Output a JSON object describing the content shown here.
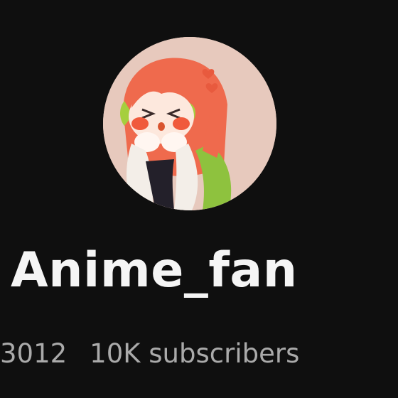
{
  "channel": {
    "name": "Anime_fan",
    "handle": "3012",
    "subscribers": "10K subscribers"
  },
  "avatar": {
    "icon": "anime-girl-avatar",
    "background_color": "#e7c9bd"
  },
  "colors": {
    "background": "#0f0f0f",
    "name_text": "#f5f5f5",
    "meta_text": "#aaaaaa"
  }
}
